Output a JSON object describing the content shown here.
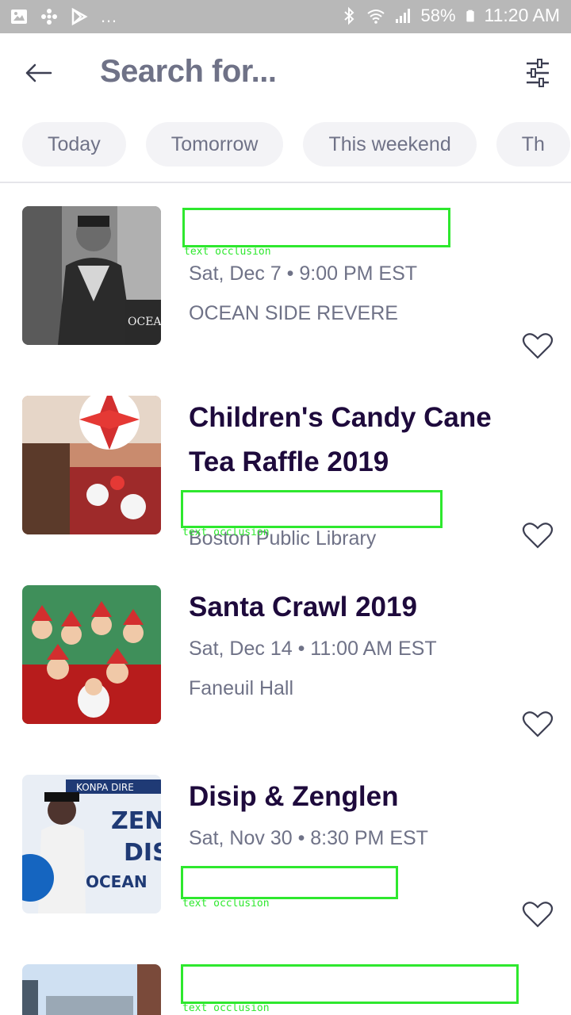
{
  "status_bar": {
    "battery": "58%",
    "time": "11:20 AM",
    "more": "…"
  },
  "header": {
    "title": "Search for...",
    "back_icon": "arrow-left-icon",
    "filter_icon": "sliders-icon"
  },
  "chips": [
    "Today",
    "Tomorrow",
    "This weekend",
    "Th"
  ],
  "events": [
    {
      "title": "",
      "date": "Sat, Dec 7 • 9:00 PM EST",
      "venue": "OCEAN SIDE REVERE"
    },
    {
      "title_line1": "Children's Candy Cane",
      "title_line2": "Tea Raffle 2019",
      "date": "",
      "venue": "Boston Public Library"
    },
    {
      "title": "Santa Crawl 2019",
      "date": "Sat, Dec 14 • 11:00 AM EST",
      "venue": "Faneuil Hall"
    },
    {
      "title": "Disip & Zenglen",
      "date": "Sat, Nov 30 • 8:30 PM EST",
      "venue": ""
    },
    {
      "title": ""
    }
  ],
  "occlusion_label": "text occlusion",
  "colors": {
    "title_text": "#1e0a3c",
    "secondary_text": "#6f7287",
    "chip_bg": "#f3f3f6",
    "status_bar": "#b8b8b8",
    "occlusion": "#2ee82e"
  }
}
